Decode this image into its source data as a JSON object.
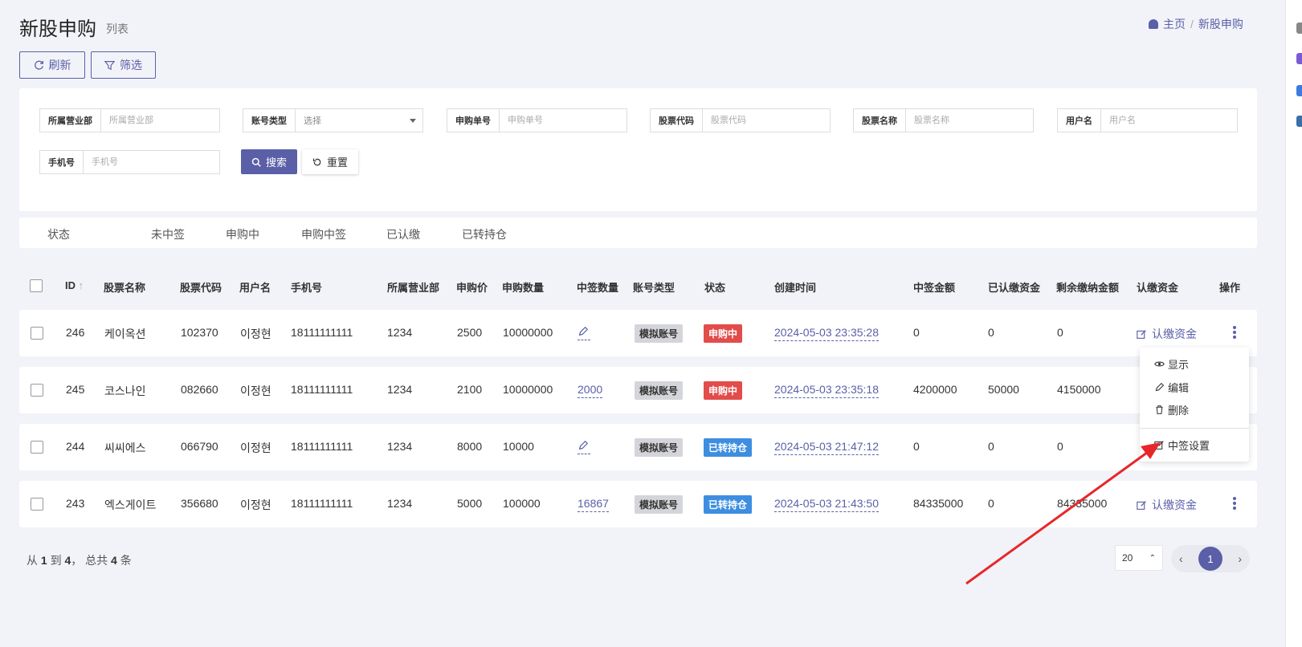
{
  "header": {
    "title": "新股申购",
    "subtitle": "列表",
    "breadcrumb_home": "主页",
    "breadcrumb_sep": "/",
    "breadcrumb_current": "新股申购"
  },
  "toolbar": {
    "refresh_label": "刷新",
    "filter_label": "筛选"
  },
  "filters": {
    "branch": {
      "label": "所属营业部",
      "placeholder": "所属营业部"
    },
    "account_type": {
      "label": "账号类型",
      "value": "选择"
    },
    "order_no": {
      "label": "申购单号",
      "placeholder": "申购单号"
    },
    "stock_code": {
      "label": "股票代码",
      "placeholder": "股票代码"
    },
    "stock_name": {
      "label": "股票名称",
      "placeholder": "股票名称"
    },
    "username": {
      "label": "用户名",
      "placeholder": "用户名"
    },
    "phone": {
      "label": "手机号",
      "placeholder": "手机号"
    },
    "search_label": "搜索",
    "reset_label": "重置"
  },
  "status_tabs": [
    "状态",
    "未中签",
    "申购中",
    "申购中签",
    "已认缴",
    "已转持仓"
  ],
  "columns": [
    "ID",
    "股票名称",
    "股票代码",
    "用户名",
    "手机号",
    "所属营业部",
    "申购价",
    "申购数量",
    "中签数量",
    "账号类型",
    "状态",
    "创建时间",
    "中签金额",
    "已认缴资金",
    "剩余缴纳金额",
    "认缴资金",
    "操作"
  ],
  "rows": [
    {
      "id": "246",
      "stock_name": "케이옥션",
      "stock_code": "102370",
      "username": "이정현",
      "phone": "18111111111",
      "branch": "1234",
      "price": "2500",
      "qty": "10000000",
      "win_qty": "",
      "account_type": "模拟账号",
      "status": "申购中",
      "status_color": "#e24c4b",
      "created": "2024-05-03 23:35:28",
      "win_amount": "0",
      "paid": "0",
      "remaining": "0",
      "action": "认缴资金"
    },
    {
      "id": "245",
      "stock_name": "코스나인",
      "stock_code": "082660",
      "username": "이정현",
      "phone": "18111111111",
      "branch": "1234",
      "price": "2100",
      "qty": "10000000",
      "win_qty": "2000",
      "account_type": "模拟账号",
      "status": "申购中",
      "status_color": "#e24c4b",
      "created": "2024-05-03 23:35:18",
      "win_amount": "4200000",
      "paid": "50000",
      "remaining": "4150000",
      "action": ""
    },
    {
      "id": "244",
      "stock_name": "씨씨에스",
      "stock_code": "066790",
      "username": "이정현",
      "phone": "18111111111",
      "branch": "1234",
      "price": "8000",
      "qty": "10000",
      "win_qty": "",
      "account_type": "模拟账号",
      "status": "已转持仓",
      "status_color": "#3d8ee0",
      "created": "2024-05-03 21:47:12",
      "win_amount": "0",
      "paid": "0",
      "remaining": "0",
      "action": ""
    },
    {
      "id": "243",
      "stock_name": "엑스게이트",
      "stock_code": "356680",
      "username": "이정현",
      "phone": "18111111111",
      "branch": "1234",
      "price": "5000",
      "qty": "100000",
      "win_qty": "16867",
      "account_type": "模拟账号",
      "status": "已转持仓",
      "status_color": "#3d8ee0",
      "created": "2024-05-03 21:43:50",
      "win_amount": "84335000",
      "paid": "0",
      "remaining": "84335000",
      "action": "认缴资金"
    }
  ],
  "dropdown": {
    "show": "显示",
    "edit": "编辑",
    "delete": "删除",
    "lottery_setting": "中签设置"
  },
  "footer": {
    "from_label": "从",
    "from": "1",
    "to_label": "到",
    "to": "4",
    "total_label": "， 总共",
    "total": "4",
    "unit": "条",
    "per_page": "20",
    "current_page": "1"
  },
  "colors": {
    "accent": "#5a5fa8",
    "danger": "#e24c4b",
    "info": "#3d8ee0",
    "annotation_arrow": "#e8262a"
  }
}
